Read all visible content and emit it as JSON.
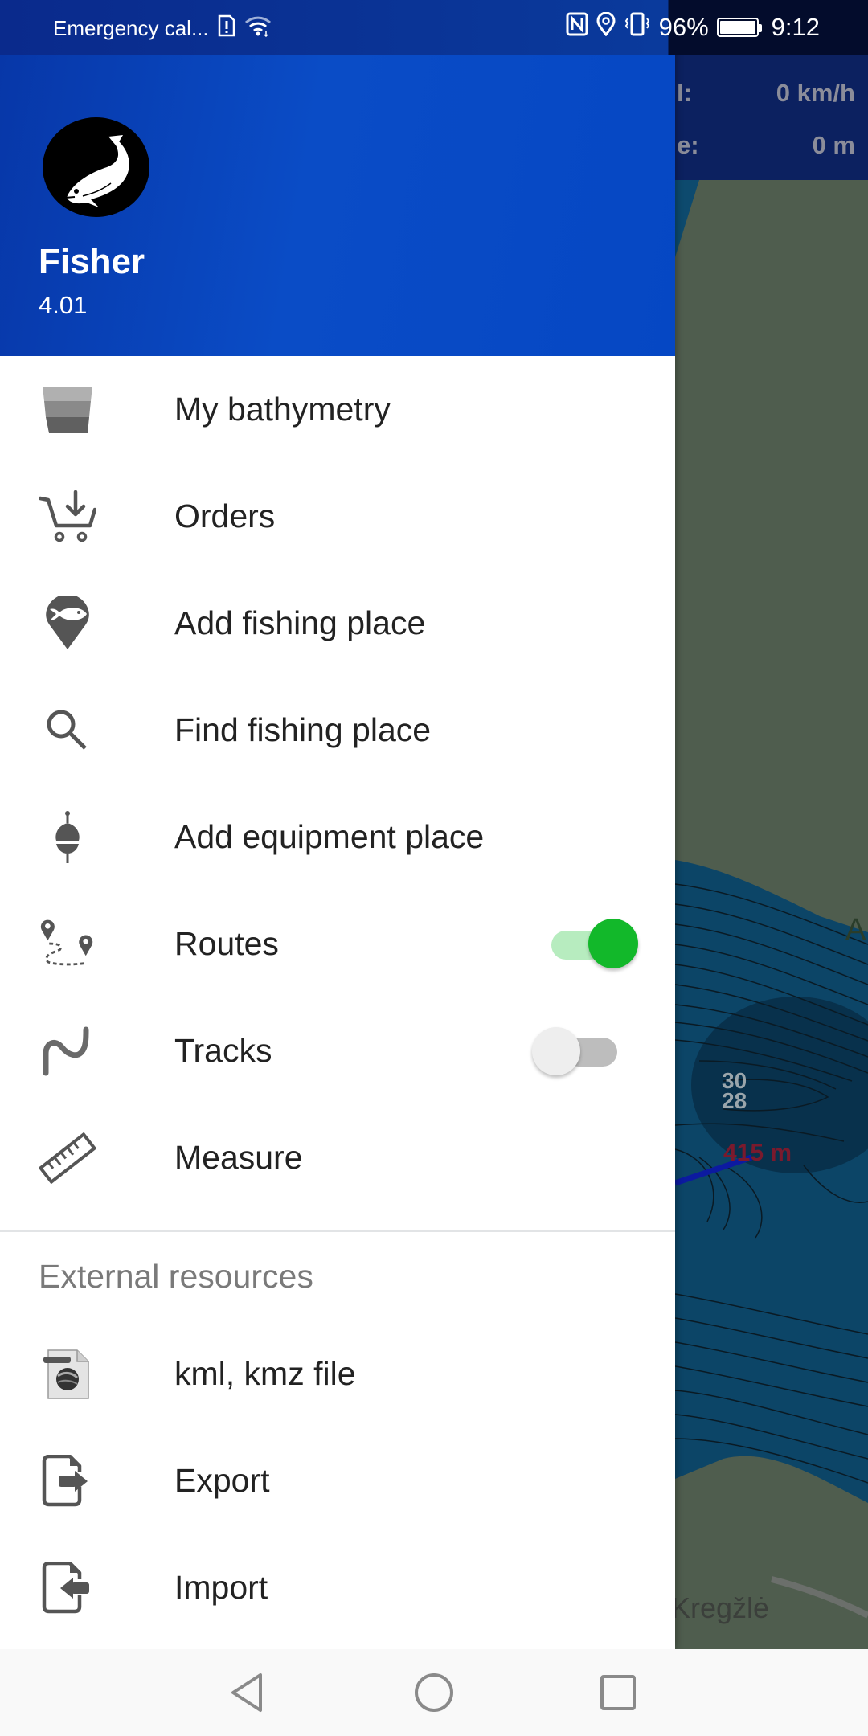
{
  "status_bar": {
    "carrier": "Emergency cal...",
    "battery_percent": "96%",
    "time": "9:12",
    "icons": [
      "sim-alert-icon",
      "wifi-icon",
      "nfc-icon",
      "location-icon",
      "vibrate-icon",
      "battery-icon"
    ]
  },
  "map": {
    "speed_label_partial": "l:",
    "speed_value": "0 km/h",
    "distance_label_partial": "e:",
    "distance_value": "0 m",
    "depth_labels": [
      "30",
      "28",
      "28"
    ],
    "distance_marker": "415 m",
    "place_label_partial": "Kregžlė",
    "edge_label_partial": "A",
    "colors": {
      "land": "#4f5d4e",
      "water": "#0d4a6e",
      "info_panel": "#0c2160",
      "route_line": "#1020a0"
    }
  },
  "drawer": {
    "header": {
      "app_name": "Fisher",
      "version": "4.01",
      "logo": "fish-logo-icon"
    },
    "items": [
      {
        "label": "My bathymetry",
        "icon": "bathymetry-icon"
      },
      {
        "label": "Orders",
        "icon": "cart-download-icon"
      },
      {
        "label": "Add fishing place",
        "icon": "fish-pin-icon"
      },
      {
        "label": "Find fishing place",
        "icon": "search-icon"
      },
      {
        "label": "Add equipment place",
        "icon": "float-bobber-icon"
      },
      {
        "label": "Routes",
        "icon": "route-pins-icon",
        "toggle": true
      },
      {
        "label": "Tracks",
        "icon": "track-curve-icon",
        "toggle": false
      },
      {
        "label": "Measure",
        "icon": "ruler-icon"
      }
    ],
    "external_section_title": "External resources",
    "external_items": [
      {
        "label": "kml, kmz file",
        "icon": "kml-file-icon"
      },
      {
        "label": "Export",
        "icon": "file-export-icon"
      },
      {
        "label": "Import",
        "icon": "file-import-icon"
      }
    ],
    "colors": {
      "header_bg": "#0a4cc6",
      "toggle_on": "#12b82a",
      "toggle_on_track": "#b7ecbf",
      "toggle_off_thumb": "#eeeeee",
      "toggle_off_track": "#bdbdbd",
      "icon_gray": "#555555"
    }
  },
  "nav_bar": {
    "buttons": [
      "back",
      "home",
      "recents"
    ]
  }
}
